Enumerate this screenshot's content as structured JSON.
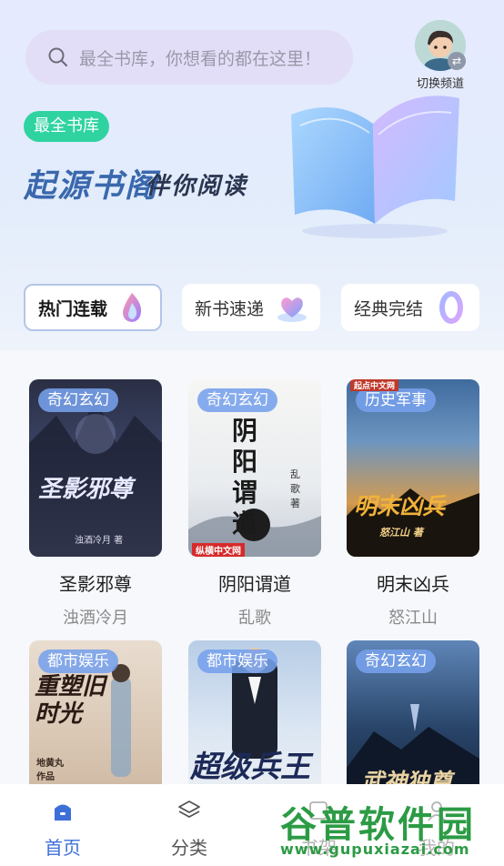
{
  "search": {
    "placeholder": "最全书库，你想看的都在这里！",
    "icon": "search-icon"
  },
  "profile": {
    "switch_label": "切换频道",
    "swap_icon": "⇄"
  },
  "hero": {
    "badge": "最全书库",
    "title": "起源书阁",
    "subtitle": "伴你阅读"
  },
  "categories": [
    {
      "label": "热门连载",
      "icon": "flame-icon",
      "active": true
    },
    {
      "label": "新书速递",
      "icon": "heart-icon",
      "active": false
    },
    {
      "label": "经典完结",
      "icon": "ring-icon",
      "active": false
    }
  ],
  "books": [
    {
      "tag": "奇幻玄幻",
      "title": "圣影邪尊",
      "author": "浊酒冷月",
      "cover_text": "圣影邪尊",
      "cover_sub": "浊酒冷月 著"
    },
    {
      "tag": "奇幻玄幻",
      "title": "阴阳谓道",
      "author": "乱歌",
      "cover_text": "阴阳谓道",
      "cover_sub": "乱歌 著",
      "cover_logo": "纵横中文网"
    },
    {
      "tag": "历史军事",
      "title": "明末凶兵",
      "author": "怒江山",
      "cover_text": "明末凶兵",
      "cover_sub": "怒江山 著",
      "cover_logo": "起点中文网"
    },
    {
      "tag": "都市娱乐",
      "cover_text": "重塑旧时光",
      "cover_sub": "地黄丸 作品"
    },
    {
      "tag": "都市娱乐",
      "cover_text": "超级兵王"
    },
    {
      "tag": "奇幻玄幻",
      "cover_text": "武神独尊"
    }
  ],
  "tabs": [
    {
      "label": "首页",
      "icon": "home-icon",
      "active": true
    },
    {
      "label": "分类",
      "icon": "layers-icon",
      "active": false
    },
    {
      "label": "书架",
      "icon": "shelf-icon",
      "active": false
    },
    {
      "label": "我的",
      "icon": "user-icon",
      "active": false
    }
  ],
  "watermark": {
    "text": "谷普软件园",
    "url": "www.gupuxiazai.com"
  },
  "colors": {
    "accent": "#3a68ad",
    "badge": "#2fd3a0",
    "tag": "#76a0ec",
    "tab_active": "#3d6fd8"
  }
}
